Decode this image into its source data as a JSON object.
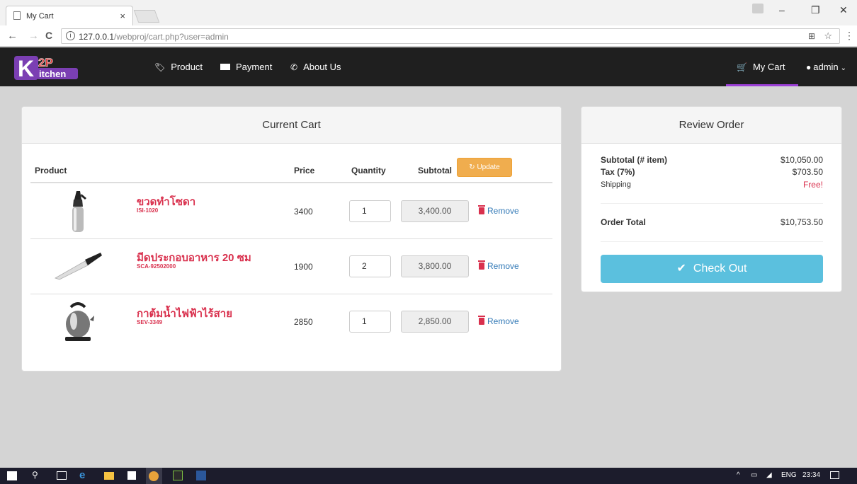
{
  "browser": {
    "tab_title": "My Cart",
    "tab_close": "×",
    "url_host": "127.0.0.1",
    "url_path": "/webproj/cart.php?user=admin",
    "info_icon": "ⓘ"
  },
  "site": {
    "logo_letter": "K",
    "logo_top": "2P",
    "logo_bottom": "itchen",
    "nav": {
      "product": "Product",
      "payment": "Payment",
      "about": "About Us",
      "mycart": "My Cart",
      "user": "admin"
    }
  },
  "cart": {
    "heading": "Current Cart",
    "columns": {
      "product": "Product",
      "price": "Price",
      "quantity": "Quantity",
      "subtotal": "Subtotal"
    },
    "update_label": "Update",
    "remove_label": "Remove",
    "items": [
      {
        "name": "ขวดทำโซดา",
        "code": "ISI-1020",
        "price": "3400",
        "qty": "1",
        "subtotal": "3,400.00",
        "icon": "soda-siphon-image"
      },
      {
        "name": "มีดประกอบอาหาร 20 ซม",
        "code": "SCA-92502000",
        "price": "1900",
        "qty": "2",
        "subtotal": "3,800.00",
        "icon": "chef-knife-image"
      },
      {
        "name": "กาต้มน้ำไฟฟ้าไร้สาย",
        "code": "SEV-3349",
        "price": "2850",
        "qty": "1",
        "subtotal": "2,850.00",
        "icon": "electric-kettle-image"
      }
    ]
  },
  "review": {
    "heading": "Review Order",
    "subtotal_label": "Subtotal (# item)",
    "subtotal_value": "$10,050.00",
    "tax_label": "Tax (7%)",
    "tax_value": "$703.50",
    "shipping_label": "Shipping",
    "shipping_value": "Free!",
    "total_label": "Order Total",
    "total_value": "$10,753.50",
    "checkout_label": "Check Out"
  },
  "taskbar": {
    "lang": "ENG",
    "time": "23:34"
  },
  "colors": {
    "accent_red": "#d9304d",
    "update_orange": "#f0ad4e",
    "checkout_blue": "#5bc0de",
    "nav_underline": "#9b3fd6"
  }
}
